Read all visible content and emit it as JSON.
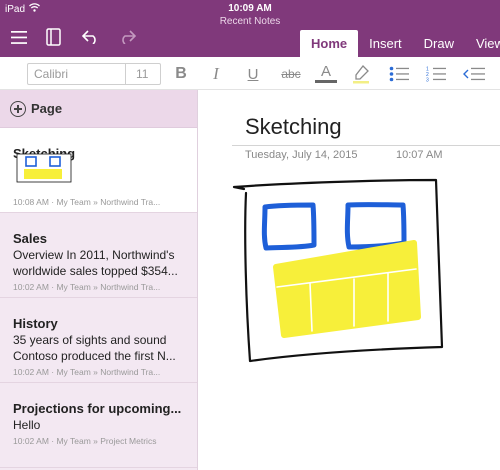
{
  "status_bar": {
    "device": "iPad",
    "time": "10:09 AM",
    "notebook_title": "Recent Notes"
  },
  "header": {
    "menu_icon": "hamburger-icon",
    "notebooks_icon": "notebooks-icon",
    "undo_icon": "undo-icon",
    "redo_icon": "redo-icon",
    "tabs": [
      {
        "label": "Home",
        "active": true
      },
      {
        "label": "Insert",
        "active": false
      },
      {
        "label": "Draw",
        "active": false
      },
      {
        "label": "View",
        "active": false
      }
    ]
  },
  "toolbar": {
    "font_name": "Calibri",
    "font_size": "11",
    "bold": "B",
    "italic": "I",
    "underline": "U",
    "strikethrough": "abc",
    "font_color": "A",
    "highlight_icon": "highlighter-icon",
    "bullets_icon": "bulleted-list-icon",
    "numbering_icon": "numbered-list-icon",
    "outdent_icon": "decrease-indent-icon"
  },
  "sidebar": {
    "add_page_label": "Page",
    "pages": [
      {
        "title": "Sketching",
        "line1": "",
        "line2": "",
        "meta": "10:08 AM · My Team » Northwind Tra...",
        "selected": true
      },
      {
        "title": "Sales",
        "line1": "Overview  In 2011, Northwind's",
        "line2": "worldwide sales topped $354...",
        "meta": "10:02 AM · My Team » Northwind Tra...",
        "selected": false
      },
      {
        "title": "History",
        "line1": "35 years of sights and sound",
        "line2": "Contoso produced the first N...",
        "meta": "10:02 AM · My Team » Northwind Tra...",
        "selected": false
      },
      {
        "title": "Projections for upcoming...",
        "line1": "Hello",
        "line2": "",
        "meta": "10:02 AM · My Team » Project Metrics",
        "selected": false
      }
    ]
  },
  "page": {
    "title": "Sketching",
    "date": "Tuesday, July 14, 2015",
    "time": "10:07 AM"
  },
  "colors": {
    "accent": "#80397b",
    "ink_blue": "#1e5fd8",
    "ink_yellow": "#f7ef3a",
    "ink_black": "#111111"
  }
}
